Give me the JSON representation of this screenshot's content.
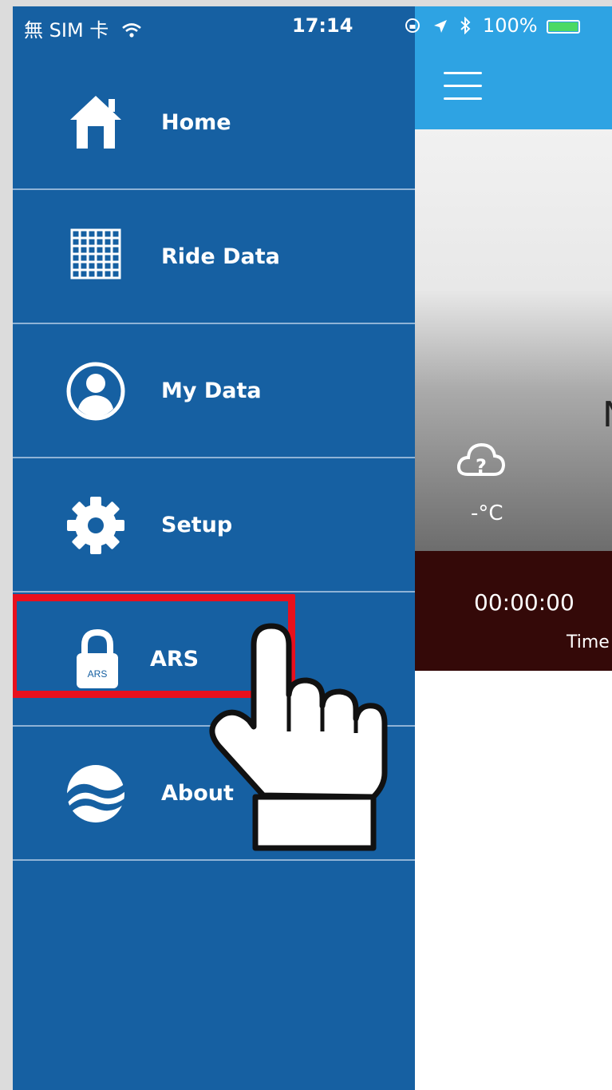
{
  "status_bar": {
    "carrier": "無 SIM 卡",
    "time": "17:14",
    "battery": "100%"
  },
  "drawer": {
    "items": [
      {
        "label": "Home",
        "icon": "home-icon"
      },
      {
        "label": "Ride Data",
        "icon": "grid-icon"
      },
      {
        "label": "My Data",
        "icon": "user-icon"
      },
      {
        "label": "Setup",
        "icon": "gear-icon"
      },
      {
        "label": "ARS",
        "icon": "lock-icon",
        "icon_text": "ARS"
      },
      {
        "label": "About",
        "icon": "logo-icon"
      }
    ]
  },
  "main": {
    "weather": {
      "temperature": "-°C",
      "icon": "cloud-question-icon"
    },
    "stats": {
      "time_value": "00:00:00",
      "time_label": "Time"
    }
  },
  "colors": {
    "drawer": "#1660a2",
    "app_bar": "#2ea3e3",
    "stats_bar": "#340908",
    "highlight": "#e8101e"
  }
}
